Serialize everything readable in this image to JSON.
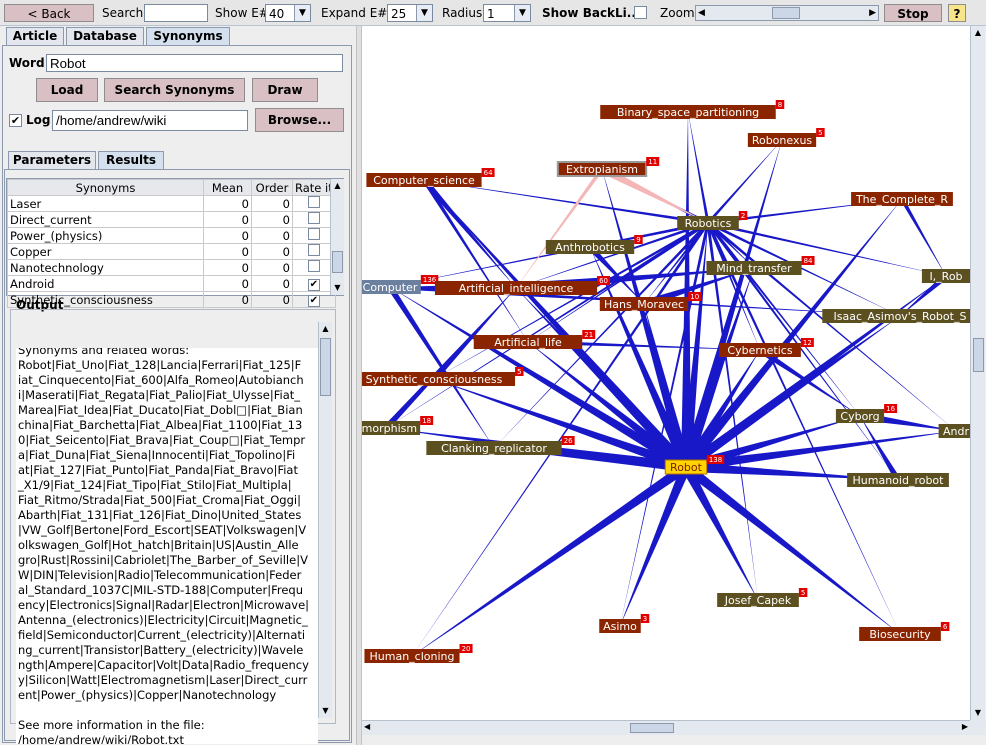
{
  "toolbar": {
    "back_label": "< Back",
    "search_label": "Search",
    "search_value": "",
    "show_label": "Show E#",
    "show_value": "40",
    "expand_label": "Expand E#",
    "expand_value": "25",
    "radius_label": "Radius",
    "radius_value": "1",
    "backlinks_label": "Show BackLi...",
    "zoom_label": "Zoom",
    "stop_label": "Stop",
    "help_label": "?"
  },
  "tabs": [
    {
      "label": "Article"
    },
    {
      "label": "Database"
    },
    {
      "label": "Synonyms"
    }
  ],
  "word": {
    "label": "Word",
    "value": "Robot"
  },
  "buttons": {
    "load": "Load",
    "search": "Search Synonyms",
    "draw": "Draw",
    "browse": "Browse..."
  },
  "log": {
    "label": "Log",
    "checked": true,
    "path": "/home/andrew/wiki"
  },
  "subtabs": [
    {
      "label": "Parameters"
    },
    {
      "label": "Results"
    }
  ],
  "table": {
    "headers": [
      "Synonyms",
      "Mean",
      "Order",
      "Rate it"
    ],
    "rows": [
      {
        "name": "Laser",
        "mean": "0",
        "order": "0",
        "rated": false
      },
      {
        "name": "Direct_current",
        "mean": "0",
        "order": "0",
        "rated": false
      },
      {
        "name": "Power_(physics)",
        "mean": "0",
        "order": "0",
        "rated": false
      },
      {
        "name": "Copper",
        "mean": "0",
        "order": "0",
        "rated": false
      },
      {
        "name": "Nanotechnology",
        "mean": "0",
        "order": "0",
        "rated": false
      },
      {
        "name": "Android",
        "mean": "0",
        "order": "0",
        "rated": true
      },
      {
        "name": "Synthetic_consciousness",
        "mean": "0",
        "order": "0",
        "rated": true
      }
    ]
  },
  "output": {
    "label": "Output",
    "lines": [
      "Synonyms and related words:",
      "Robot|Fiat_Uno|Fiat_128|Lancia|Ferrari|Fiat_125|F",
      "iat_Cinquecento|Fiat_600|Alfa_Romeo|Autobianch",
      "i|Maserati|Fiat_Regata|Fiat_Palio|Fiat_Ulysse|Fiat_",
      "Marea|Fiat_Idea|Fiat_Ducato|Fiat_Dobl□|Fiat_Bian",
      "china|Fiat_Barchetta|Fiat_Albea|Fiat_1100|Fiat_13",
      "0|Fiat_Seicento|Fiat_Brava|Fiat_Coup□|Fiat_Tempr",
      "a|Fiat_Duna|Fiat_Siena|Innocenti|Fiat_Topolino|Fi",
      "at|Fiat_127|Fiat_Punto|Fiat_Panda|Fiat_Bravo|Fiat",
      "_X1/9|Fiat_124|Fiat_Tipo|Fiat_Stilo|Fiat_Multipla|",
      "Fiat_Ritmo/Strada|Fiat_500|Fiat_Croma|Fiat_Oggi|",
      "Abarth|Fiat_131|Fiat_126|Fiat_Dino|United_States",
      "|VW_Golf|Bertone|Ford_Escort|SEAT|Volkswagen|V",
      "olkswagen_Golf|Hot_hatch|Britain|US|Austin_Alle",
      "gro|Rust|Rossini|Cabriolet|The_Barber_of_Seville|V",
      "W|DIN|Television|Radio|Telecommunication|Feder",
      "al_Standard_1037C|MIL-STD-188|Computer|Frequ",
      "ency|Electronics|Signal|Radar|Electron|Microwave|",
      "Antenna_(electronics)|Electricity|Circuit|Magnetic_",
      "field|Semiconductor|Current_(electricity)|Alternati",
      "ng_current|Transistor|Battery_(electricity)|Wavele",
      "ngth|Ampere|Capacitor|Volt|Data|Radio_frequency",
      "y|Silicon|Watt|Electromagnetism|Laser|Direct_curr",
      "ent|Power_(physics)|Copper|Nanotechnology",
      "",
      "See more information in the file:",
      "/home/andrew/wiki/Robot.txt"
    ]
  },
  "colors": {
    "node_red": "#8b2500",
    "node_olive": "#5c5020",
    "node_blue": "#6b7f9e",
    "edge": "#1818c8",
    "highlight": "#ffd400"
  },
  "graph": {
    "nodes": [
      {
        "id": "robot",
        "label": "Robot",
        "count": "138",
        "kind": "highlight"
      },
      {
        "id": "robotics",
        "label": "Robotics",
        "count": "2",
        "kind": "olive"
      },
      {
        "id": "bsp",
        "label": "Binary_space_partitioning",
        "count": "8",
        "kind": "red"
      },
      {
        "id": "robonexus",
        "label": "Robonexus",
        "count": "5",
        "kind": "red"
      },
      {
        "id": "extropianism",
        "label": "Extropianism",
        "count": "11",
        "kind": "redbox"
      },
      {
        "id": "cs",
        "label": "Computer_science",
        "count": "64",
        "kind": "red"
      },
      {
        "id": "tcr",
        "label": "The_Complete_R",
        "count": "",
        "kind": "red"
      },
      {
        "id": "anthrobotics",
        "label": "Anthrobotics",
        "count": "9",
        "kind": "olive"
      },
      {
        "id": "mind",
        "label": "Mind_transfer",
        "count": "84",
        "kind": "olive"
      },
      {
        "id": "irob",
        "label": "I,_Rob",
        "count": "",
        "kind": "olive"
      },
      {
        "id": "computer",
        "label": "Computer",
        "count": "136",
        "kind": "blue"
      },
      {
        "id": "ai",
        "label": "Artificial_intelligence",
        "count": "60",
        "kind": "red"
      },
      {
        "id": "moravec",
        "label": "Hans_Moravec",
        "count": "10",
        "kind": "red"
      },
      {
        "id": "asimovseries",
        "label": "Isaac_Asimov's_Robot_S",
        "count": "",
        "kind": "olive"
      },
      {
        "id": "alife",
        "label": "Artificial_life",
        "count": "21",
        "kind": "red"
      },
      {
        "id": "cybernetics",
        "label": "Cybernetics",
        "count": "12",
        "kind": "red"
      },
      {
        "id": "synth",
        "label": "Synthetic_consciousness",
        "count": "5",
        "kind": "red"
      },
      {
        "id": "cyborg",
        "label": "Cyborg",
        "count": "16",
        "kind": "olive"
      },
      {
        "id": "android",
        "label": "Andr",
        "count": "",
        "kind": "olive"
      },
      {
        "id": "morphism",
        "label": "omorphism",
        "count": "18",
        "kind": "olive"
      },
      {
        "id": "clanking",
        "label": "Clanking_replicator",
        "count": "26",
        "kind": "olive"
      },
      {
        "id": "humanoid",
        "label": "Humanoid_robot",
        "count": "",
        "kind": "olive"
      },
      {
        "id": "capek",
        "label": "Josef_Capek",
        "count": "5",
        "kind": "olive"
      },
      {
        "id": "asimo",
        "label": "Asimo",
        "count": "3",
        "kind": "red"
      },
      {
        "id": "biosecurity",
        "label": "Biosecurity",
        "count": "6",
        "kind": "red"
      },
      {
        "id": "cloning",
        "label": "Human_cloning",
        "count": "20",
        "kind": "red"
      }
    ]
  }
}
